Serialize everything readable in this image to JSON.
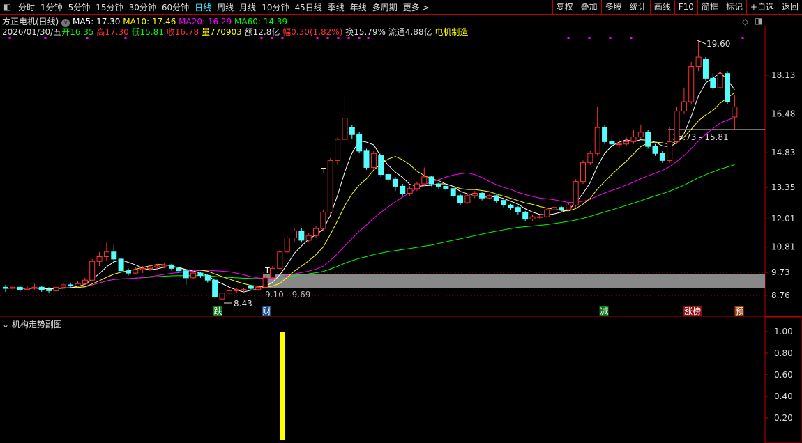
{
  "toolbar": {
    "periods": [
      "分时",
      "1分钟",
      "5分钟",
      "15分钟",
      "30分钟",
      "60分钟",
      "日线",
      "周线",
      "月线",
      "10分钟",
      "45日线",
      "季线",
      "年线",
      "多周期",
      "更多 >"
    ],
    "active": "日线",
    "tools": [
      "复权",
      "叠加",
      "多股",
      "统计",
      "画线",
      "F10",
      "简框",
      "标记",
      "+自选",
      "返回"
    ]
  },
  "header": {
    "title": "方正电机(日线)",
    "ma5": "MA5: 17.30",
    "ma10": "MA10: 17.46",
    "ma20": "MA20: 16.29",
    "ma60": "MA60: 14.39"
  },
  "quote": {
    "date": "2026/01/30/五",
    "open": "开16.35",
    "high": "高17.30",
    "low": "低15.81",
    "close": "收16.78",
    "volume": "量770903",
    "amount": "额12.8亿",
    "change": "幅0.30(1.82%)",
    "turnover": "换15.79%",
    "float": "流通4.88亿",
    "industry": "电机制造"
  },
  "colors": {
    "up": "#ff3333",
    "down": "#54fcfc",
    "ma5": "#ffffff",
    "ma10": "#ffff00",
    "ma20": "#ff00ff",
    "ma60": "#00ff00",
    "band": "#888888"
  },
  "axis": {
    "price_ticks": [
      "18.13",
      "16.48",
      "14.83",
      "13.35",
      "12.01",
      "10.81",
      "9.73",
      "8.76"
    ],
    "sub_ticks": [
      "1.00",
      "0.80",
      "0.60",
      "0.40",
      "0.20"
    ]
  },
  "annotations": {
    "high_label": "19.60",
    "low_label": "8.43",
    "zone_label": "9.10 - 9.69",
    "line_label": "15.73 - 15.81",
    "t1": "T",
    "t2": "T"
  },
  "markers": [
    {
      "text": "跌",
      "color": "#0a7a1a"
    },
    {
      "text": "财",
      "color": "#1a4a8a"
    },
    {
      "text": "减",
      "color": "#0a7a1a"
    },
    {
      "text": "涨榜",
      "color": "#8a1010"
    },
    {
      "text": "预",
      "color": "#a04010"
    }
  ],
  "subchart": {
    "title": "机构走势副图",
    "bar_value": 1.0
  },
  "candles": [
    [
      9.1,
      9.2,
      8.9,
      9.05
    ],
    [
      9.05,
      9.2,
      8.95,
      9.1
    ],
    [
      9.1,
      9.15,
      8.9,
      9.0
    ],
    [
      9.0,
      9.15,
      8.95,
      9.05
    ],
    [
      9.05,
      9.25,
      9.0,
      9.1
    ],
    [
      9.1,
      9.15,
      8.9,
      9.0
    ],
    [
      9.0,
      9.1,
      8.85,
      8.95
    ],
    [
      8.95,
      9.2,
      8.9,
      9.1
    ],
    [
      9.1,
      9.3,
      9.05,
      9.2
    ],
    [
      9.2,
      9.3,
      9.1,
      9.15
    ],
    [
      9.15,
      9.35,
      9.1,
      9.25
    ],
    [
      9.25,
      9.5,
      9.2,
      9.4
    ],
    [
      9.4,
      10.3,
      9.35,
      10.2
    ],
    [
      10.2,
      10.6,
      10.0,
      10.4
    ],
    [
      10.4,
      11.0,
      10.2,
      10.6
    ],
    [
      10.6,
      10.9,
      10.1,
      10.3
    ],
    [
      10.3,
      10.35,
      9.7,
      9.8
    ],
    [
      9.8,
      9.9,
      9.6,
      9.7
    ],
    [
      9.7,
      9.95,
      9.65,
      9.85
    ],
    [
      9.85,
      10.0,
      9.7,
      9.9
    ],
    [
      9.9,
      10.05,
      9.8,
      9.95
    ],
    [
      9.95,
      10.1,
      9.85,
      10.0
    ],
    [
      10.0,
      10.15,
      9.9,
      10.05
    ],
    [
      10.05,
      10.1,
      9.8,
      9.9
    ],
    [
      9.9,
      9.95,
      9.7,
      9.8
    ],
    [
      9.8,
      9.85,
      9.2,
      9.5
    ],
    [
      9.5,
      9.8,
      9.45,
      9.7
    ],
    [
      9.7,
      9.75,
      9.5,
      9.6
    ],
    [
      9.6,
      9.65,
      9.3,
      9.4
    ],
    [
      9.4,
      9.45,
      8.65,
      8.7
    ],
    [
      8.6,
      8.9,
      8.43,
      8.85
    ],
    [
      8.85,
      9.0,
      8.8,
      8.95
    ],
    [
      8.95,
      9.05,
      8.85,
      9.0
    ],
    [
      9.0,
      9.05,
      8.9,
      9.0
    ],
    [
      9.15,
      9.2,
      9.0,
      9.05
    ],
    [
      9.0,
      9.15,
      8.95,
      9.1
    ],
    [
      9.1,
      9.6,
      9.05,
      9.5
    ],
    [
      9.5,
      10.0,
      9.4,
      9.9
    ],
    [
      9.9,
      10.7,
      9.85,
      10.6
    ],
    [
      10.6,
      11.3,
      10.5,
      11.2
    ],
    [
      11.2,
      11.6,
      11.0,
      11.5
    ],
    [
      11.5,
      11.6,
      11.0,
      11.1
    ],
    [
      11.1,
      11.4,
      11.0,
      11.3
    ],
    [
      11.3,
      11.7,
      11.2,
      11.6
    ],
    [
      11.6,
      12.4,
      11.5,
      12.3
    ],
    [
      12.3,
      14.6,
      12.2,
      14.5
    ],
    [
      14.5,
      15.5,
      14.3,
      15.4
    ],
    [
      15.4,
      17.3,
      15.3,
      16.3
    ],
    [
      15.9,
      16.0,
      15.4,
      15.6
    ],
    [
      15.6,
      15.7,
      14.8,
      14.9
    ],
    [
      14.9,
      15.0,
      14.1,
      14.2
    ],
    [
      14.2,
      14.9,
      14.1,
      14.8
    ],
    [
      14.7,
      14.8,
      13.8,
      13.9
    ],
    [
      13.9,
      14.1,
      13.5,
      13.7
    ],
    [
      13.7,
      13.8,
      13.2,
      13.4
    ],
    [
      13.4,
      13.5,
      13.0,
      13.1
    ],
    [
      13.1,
      13.4,
      13.0,
      13.3
    ],
    [
      13.3,
      13.6,
      13.2,
      13.5
    ],
    [
      13.5,
      14.2,
      13.4,
      13.8
    ],
    [
      13.8,
      13.85,
      13.4,
      13.5
    ],
    [
      13.5,
      13.55,
      13.3,
      13.4
    ],
    [
      13.4,
      13.45,
      13.2,
      13.3
    ],
    [
      13.3,
      13.35,
      12.9,
      13.0
    ],
    [
      13.0,
      13.05,
      12.6,
      12.7
    ],
    [
      12.7,
      13.1,
      12.65,
      13.0
    ],
    [
      13.0,
      13.2,
      12.9,
      13.1
    ],
    [
      13.1,
      13.15,
      12.8,
      12.9
    ],
    [
      12.9,
      13.05,
      12.85,
      13.0
    ],
    [
      13.0,
      13.05,
      12.7,
      12.8
    ],
    [
      12.8,
      12.85,
      12.5,
      12.6
    ],
    [
      12.6,
      12.65,
      12.4,
      12.5
    ],
    [
      12.5,
      12.55,
      12.2,
      12.3
    ],
    [
      12.3,
      12.35,
      11.9,
      12.0
    ],
    [
      12.0,
      12.2,
      11.9,
      12.1
    ],
    [
      12.1,
      12.2,
      12.0,
      12.1
    ],
    [
      12.1,
      12.5,
      12.05,
      12.4
    ],
    [
      12.4,
      12.6,
      12.3,
      12.5
    ],
    [
      12.5,
      12.55,
      12.3,
      12.4
    ],
    [
      12.4,
      12.7,
      12.35,
      12.6
    ],
    [
      12.6,
      13.7,
      12.5,
      13.6
    ],
    [
      13.6,
      14.5,
      13.5,
      14.4
    ],
    [
      14.4,
      14.9,
      14.3,
      14.8
    ],
    [
      14.8,
      16.8,
      14.7,
      15.9
    ],
    [
      15.9,
      16.0,
      15.2,
      15.3
    ],
    [
      15.3,
      15.6,
      15.1,
      15.2
    ],
    [
      15.2,
      15.4,
      15.0,
      15.2
    ],
    [
      15.2,
      15.5,
      15.1,
      15.3
    ],
    [
      15.3,
      15.8,
      15.2,
      15.5
    ],
    [
      15.5,
      16.0,
      15.4,
      15.7
    ],
    [
      15.7,
      15.8,
      15.0,
      15.1
    ],
    [
      15.1,
      15.2,
      14.7,
      14.8
    ],
    [
      14.8,
      14.9,
      14.4,
      14.5
    ],
    [
      14.5,
      15.9,
      14.4,
      15.3
    ],
    [
      15.3,
      16.8,
      15.2,
      16.6
    ],
    [
      16.6,
      17.6,
      16.5,
      17.0
    ],
    [
      17.0,
      18.7,
      16.9,
      18.5
    ],
    [
      18.5,
      19.6,
      18.3,
      18.9
    ],
    [
      18.8,
      18.9,
      17.9,
      18.0
    ],
    [
      18.0,
      18.2,
      17.5,
      17.6
    ],
    [
      17.6,
      18.4,
      17.5,
      18.2
    ],
    [
      18.2,
      18.3,
      16.9,
      17.0
    ],
    [
      16.35,
      17.3,
      15.81,
      16.78
    ]
  ],
  "dots_x": [
    14,
    65,
    125,
    180,
    375,
    390,
    405,
    455,
    470,
    485,
    500,
    515,
    528,
    815,
    845,
    875,
    905,
    1065
  ]
}
